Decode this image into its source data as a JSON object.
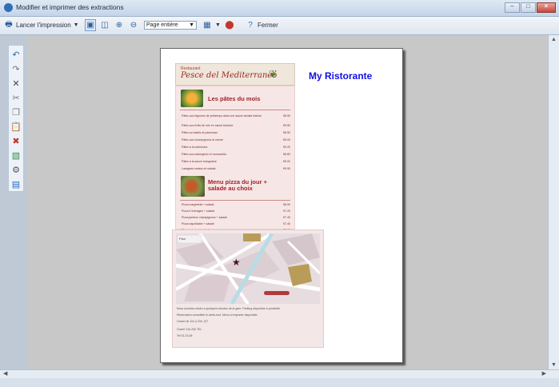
{
  "window": {
    "title": "Modifier et imprimer des extractions"
  },
  "toolbar": {
    "print_label": "Lancer l'impression",
    "zoom_value": "Page entière",
    "close_label": "Fermer"
  },
  "page": {
    "banner_line": "Restaurant",
    "banner_name": "Pesce del Mediterraneo",
    "brand": "My Ristorante",
    "sections": [
      {
        "title": "Les pâtes du mois",
        "rows": [
          {
            "item": "Pâtes aux légumes de printemps dans une sauce tomate fraîche",
            "price": "€8.90"
          },
          {
            "item": "Pâtes aux fruits de mer en sauce blanche",
            "price": "€9.50"
          },
          {
            "item": "Pâtes au basilic et parmesan",
            "price": "€8.50"
          },
          {
            "item": "Pâtes aux champignons et crème",
            "price": "€9.00"
          },
          {
            "item": "Pâtes à la carbonara",
            "price": "€9.20"
          },
          {
            "item": "Pâtes aux aubergines et mozzarella",
            "price": "€8.80"
          },
          {
            "item": "Pâtes à la sauce bolognaise",
            "price": "€9.00"
          },
          {
            "item": "Lasagnes maison et salade",
            "price": "€9.90"
          }
        ]
      },
      {
        "title": "Menu pizza du jour + salade au choix",
        "rows": [
          {
            "item": "Pizza margherita + salade",
            "price": "€8.90"
          },
          {
            "item": "Pizza 4 fromages + salade",
            "price": "€7.20"
          },
          {
            "item": "Pizza jambon champignons + salade",
            "price": "€7.40"
          },
          {
            "item": "Pizza napolitaine + salade",
            "price": "€7.40"
          },
          {
            "item": "Pizza calzone + salade",
            "price": "€8.10"
          }
        ]
      }
    ],
    "map_label": "Plan",
    "map_info": [
      "Nous sommes situés à quelques minutes de la gare. Parking disponible à proximité.",
      "Réservation conseillée le week-end. Menu à emporter disponible.",
      "Ouvert de 11h à 23h, 7j/7.",
      "Ouvert 11h-23h TEL",
      "Tel 01-23-45"
    ]
  }
}
